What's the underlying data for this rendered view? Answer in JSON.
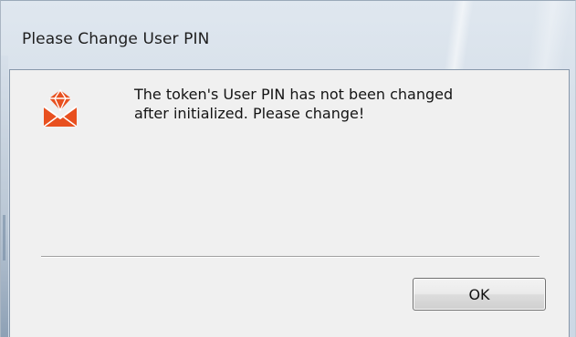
{
  "window": {
    "title": "Please Change User PIN"
  },
  "dialog": {
    "icon": "token-mail-icon",
    "icon_color": "#e8501f",
    "message_lines": [
      "The token's User PIN has not been changed",
      "after initialized. Please change!"
    ],
    "ok_label": "OK"
  }
}
